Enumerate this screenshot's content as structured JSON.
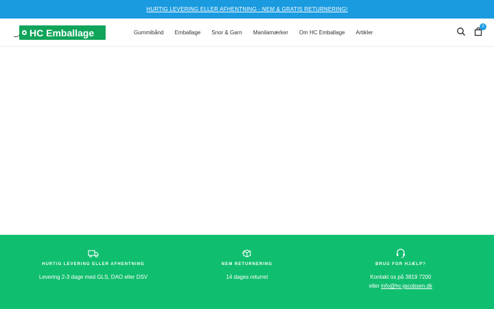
{
  "announcement": {
    "text": "HURTIG LEVERING ELLER AFHENTNING - NEM & GRATIS RETURNERING!"
  },
  "header": {
    "logo_text": "HC Emballage",
    "nav": [
      {
        "label": "Gummibånd"
      },
      {
        "label": "Emballage"
      },
      {
        "label": "Snor & Garn"
      },
      {
        "label": "Manilamærker"
      },
      {
        "label": "Om HC Emballage"
      },
      {
        "label": "Artikler"
      }
    ],
    "icons": [
      "search-icon",
      "cart-icon"
    ],
    "cart_count": "0"
  },
  "footer": {
    "features": [
      {
        "icon": "truck-icon",
        "title": "HURTIG LEVERING ELLER AFHENTNING",
        "line1": "Levering 2-3 dage med GLS, DAO eller DSV"
      },
      {
        "icon": "return-box-icon",
        "title": "NEM RETURNERING",
        "line1": "14 dages returret"
      },
      {
        "icon": "headset-icon",
        "title": "BRUG FOR HJÆLP?",
        "line1": "Kontakt os på 3819 7200",
        "line2_prefix": "eller ",
        "line2_link": "info@hc-jacobsen.dk"
      }
    ]
  },
  "colors": {
    "announcement": "#1a9be0",
    "brand_green": "#10a55a",
    "footer_green": "#0fbe6e"
  }
}
